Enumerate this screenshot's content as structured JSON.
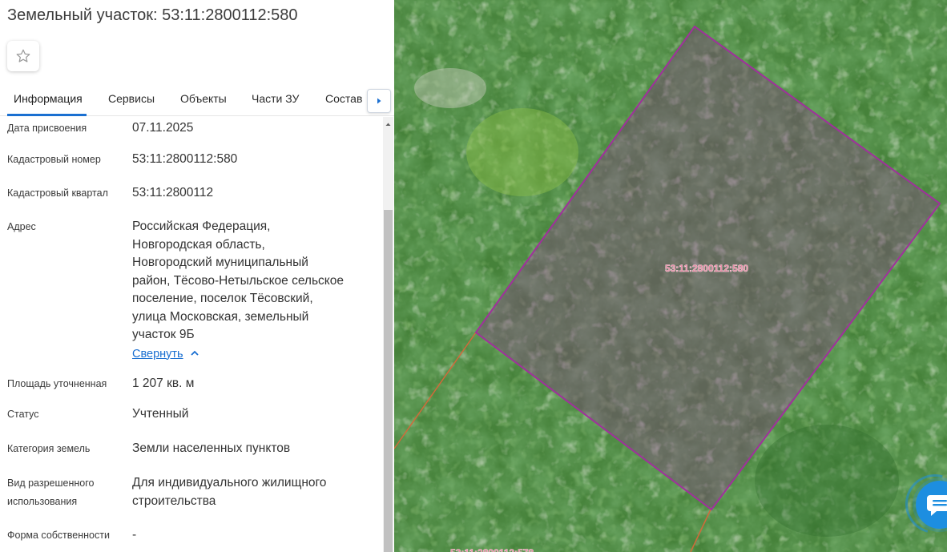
{
  "header": {
    "title": "Земельный участок: 53:11:2800112:580"
  },
  "tabs": [
    {
      "label": "Информация",
      "active": true
    },
    {
      "label": "Сервисы",
      "active": false
    },
    {
      "label": "Объекты",
      "active": false
    },
    {
      "label": "Части ЗУ",
      "active": false
    },
    {
      "label": "Состав",
      "active": false
    }
  ],
  "info": {
    "assign_date_label": "Дата присвоения",
    "assign_date_value": "07.11.2025",
    "cad_number_label": "Кадастровый номер",
    "cad_number_value": "53:11:2800112:580",
    "cad_quarter_label": "Кадастровый квартал",
    "cad_quarter_value": "53:11:2800112",
    "address_label": "Адрес",
    "address_lines": [
      "Российская Федерация,",
      "Новгородская область,",
      "Новгородский муниципальный",
      "район, Тёсово-Нетыльское сельское",
      "поселение, поселок Тёсовский,",
      "улица Московская, земельный",
      "участок 9Б"
    ],
    "collapse_label": "Свернуть",
    "area_label": "Площадь уточненная",
    "area_value": "1 207 кв. м",
    "status_label": "Статус",
    "status_value": "Учтенный",
    "category_label": "Категория земель",
    "category_value": "Земли населенных пунктов",
    "usage_label_lines": [
      "Вид разрешенного",
      "использования"
    ],
    "usage_value_lines": [
      "Для индивидуального жилищного",
      "строительства"
    ],
    "ownership_label": "Форма собственности",
    "ownership_value": "-"
  },
  "map": {
    "parcel_label": "53:11:2800112:580",
    "parcel_color": "#a0309c",
    "neighbor_boundary_color": "#d2693a",
    "chat_button_color": "#1d8ee0"
  },
  "icons": {
    "favorite": "star-icon",
    "tabs_next": "chevron-right-icon",
    "collapse": "chevron-up-icon",
    "chat": "chat-icon"
  }
}
